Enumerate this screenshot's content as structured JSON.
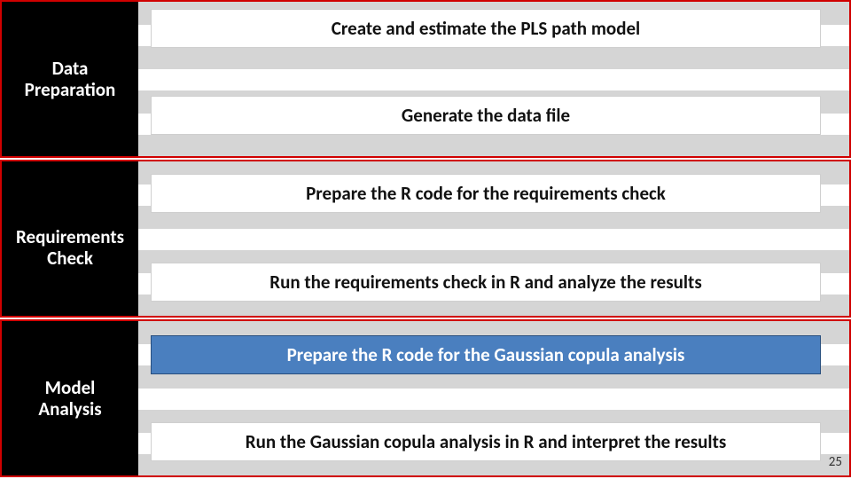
{
  "sections": [
    {
      "label": "Data\nPreparation",
      "steps": [
        {
          "text": "Create and estimate the PLS path model",
          "highlight": false
        },
        {
          "text": "Generate the data file",
          "highlight": false
        }
      ]
    },
    {
      "label": "Requirements\nCheck",
      "steps": [
        {
          "text": "Prepare the R code for the requirements check",
          "highlight": false
        },
        {
          "text": "Run the requirements check in R and analyze the results",
          "highlight": false
        }
      ]
    },
    {
      "label": "Model\nAnalysis",
      "steps": [
        {
          "text": "Prepare the R code for the Gaussian copula analysis",
          "highlight": true
        },
        {
          "text": "Run the Gaussian copula analysis in R and interpret the results",
          "highlight": false
        }
      ]
    }
  ],
  "page_number": "25"
}
